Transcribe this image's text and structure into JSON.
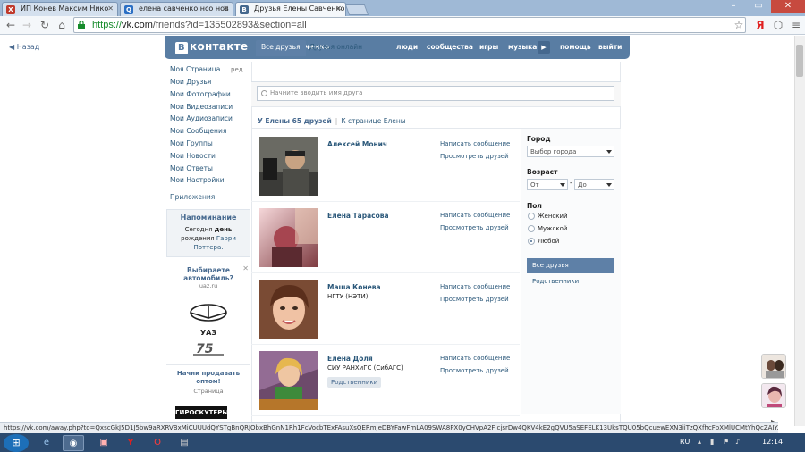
{
  "browser": {
    "tabs": [
      {
        "label": "ИП Конев Максим Нико",
        "favicon": "X",
        "favicon_color": "#c0392b"
      },
      {
        "label": "елена савченко нсо нов",
        "favicon": "Q",
        "favicon_color": "#2b6fc4"
      },
      {
        "label": "Друзья Елены Савченко",
        "favicon": "B",
        "favicon_color": "#45688e"
      }
    ],
    "url_https": "https://",
    "url_host": "vk.com",
    "url_rest": "/friends?id=135502893&section=all",
    "status_url": "https://vk.com/away.php?to=QxscGkJ5D1J5bw9aRXRVBxMiCUUUdQYSTgBnQRJObxBhGnN1Rh1FcVocbTExFAsuXsQERmJeDBYFawFmLA09SWA8PX0yCHVpA2FIcjsrDw4QKV4kE2gQVU5aSEFELK13UksTQU05bQcuewEXN3iiTzQXfhcFbXMlUCMtYhQcZAIY..."
  },
  "vk": {
    "logo_text": "контакте",
    "logo_letter": "В",
    "back_label": "Назад",
    "header_user": "Елена Савченко",
    "top_nav": [
      "люди",
      "сообщества",
      "игры",
      "музыка",
      "помощь",
      "выйти"
    ],
    "left_menu": [
      "Моя Страница",
      "Мои Друзья",
      "Мои Фотографии",
      "Мои Видеозаписи",
      "Мои Аудиозаписи",
      "Мои Сообщения",
      "Мои Группы",
      "Мои Новости",
      "Мои Ответы",
      "Мои Настройки"
    ],
    "edit_label": "ред.",
    "apps_label": "Приложения",
    "reminder": {
      "title": "Напоминание",
      "line1a": "Сегодня ",
      "line1b": "день",
      "line2a": "рождения ",
      "line2b": "Гарри",
      "line3": "Поттера."
    },
    "ad": {
      "title": "Выбираете автомобиль?",
      "domain": "uaz.ru",
      "brand": "УАЗ",
      "sell_title": "Начни продавать оптом!",
      "sell_sub": "Страница",
      "banner": "ГИРОСКУТЕРЫ"
    },
    "tabs": [
      "Все друзья",
      "Друзья онлайн"
    ],
    "search_placeholder": "Начните вводить имя друга",
    "summary": {
      "count_text": "У Елены 65 друзей",
      "page_link": "К странице Елены"
    },
    "friends": [
      {
        "name": "Алексей Монич",
        "sub": "",
        "tag": "",
        "action_message": "Написать сообщение",
        "action_friends": "Просмотреть друзей"
      },
      {
        "name": "Елена Тарасова",
        "sub": "",
        "tag": "",
        "action_message": "Написать сообщение",
        "action_friends": "Просмотреть друзей"
      },
      {
        "name": "Маша Конева",
        "sub": "НГТУ (НЭТИ)",
        "tag": "",
        "action_message": "Написать сообщение",
        "action_friends": "Просмотреть друзей"
      },
      {
        "name": "Елена Доля",
        "sub": "СИУ РАНХиГС (СибАГС)",
        "tag": "Родственники",
        "action_message": "Написать сообщение",
        "action_friends": "Просмотреть друзей"
      }
    ],
    "filters": {
      "city_label": "Город",
      "city_value": "Выбор города",
      "age_label": "Возраст",
      "age_from": "От",
      "age_dash": "-",
      "age_to": "До",
      "gender_label": "Пол",
      "genders": [
        "Женский",
        "Мужской",
        "Любой"
      ],
      "selected_gender": "Любой",
      "list_all": "Все друзья",
      "list_relatives": "Родственники"
    }
  },
  "taskbar": {
    "lang": "RU",
    "time": "12:14"
  }
}
